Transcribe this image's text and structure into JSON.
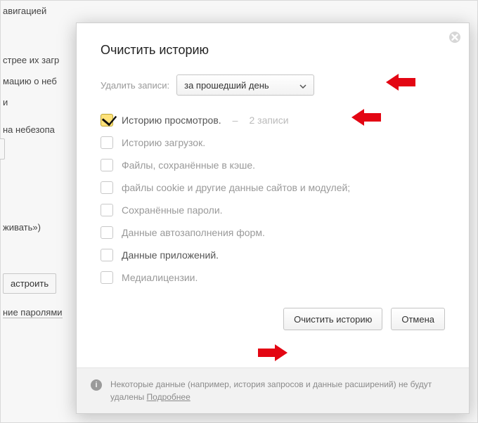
{
  "bg": {
    "frag_nav": "авигацией",
    "frag_loading": "стрее их загр",
    "frag_unsafe_info": "мацию о неб",
    "frag_unsafe_redirect": "на небезопа",
    "frag_track": "живать»)",
    "btn_configure": "астроить",
    "link_passwords": "ние паролями",
    "frag_single": "и"
  },
  "dialog": {
    "title": "Очистить историю",
    "delete_label": "Удалить записи:",
    "select_value": "за прошедший день",
    "options": [
      {
        "label": "Историю просмотров.",
        "count": "2 записи",
        "checked": true
      },
      {
        "label": "Историю загрузок.",
        "checked": false
      },
      {
        "label": "Файлы, сохранённые в кэше.",
        "checked": false
      },
      {
        "label": "файлы cookie и другие данные сайтов и модулей;",
        "checked": false
      },
      {
        "label": "Сохранённые пароли.",
        "checked": false
      },
      {
        "label": "Данные автозаполнения форм.",
        "checked": false
      },
      {
        "label": "Данные приложений.",
        "checked": false
      },
      {
        "label": "Медиалицензии.",
        "checked": false
      }
    ],
    "btn_clear": "Очистить историю",
    "btn_cancel": "Отмена",
    "footer_text": "Некоторые данные (например, история запросов и данные расширений) не будут удалены ",
    "footer_more": "Подробнее"
  }
}
